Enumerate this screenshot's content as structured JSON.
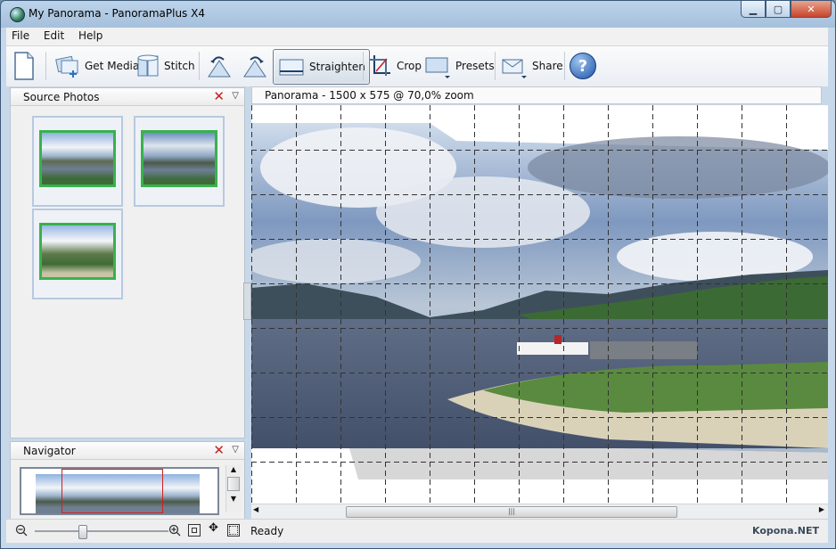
{
  "window": {
    "title": "My Panorama - PanoramaPlus X4",
    "controls": {
      "minimize": "▁",
      "maximize": "▢",
      "close": "✕"
    }
  },
  "menu": {
    "items": [
      {
        "label": "File"
      },
      {
        "label": "Edit"
      },
      {
        "label": "Help"
      }
    ]
  },
  "toolbar": {
    "new_icon": "document-icon",
    "get_media": "Get Media",
    "stitch": "Stitch",
    "rotate_left_icon": "rotate-left-icon",
    "rotate_right_icon": "rotate-right-icon",
    "straighten": "Straighten",
    "crop": "Crop",
    "presets": "Presets",
    "share": "Share",
    "help_icon": "help-icon",
    "help_glyph": "?"
  },
  "source_photos": {
    "title": "Source Photos",
    "close_glyph": "✕",
    "menu_glyph": "▽",
    "photos": [
      {
        "name": "photo-1"
      },
      {
        "name": "photo-2"
      },
      {
        "name": "photo-3"
      }
    ]
  },
  "navigator": {
    "title": "Navigator",
    "close_glyph": "✕",
    "menu_glyph": "▽"
  },
  "canvas": {
    "info": "Panorama - 1500 x 575 @ 70,0% zoom",
    "scroll_grip": "|||"
  },
  "status": {
    "text": "Ready",
    "zoom_level": 0.35
  },
  "watermark": "Kopona.NET",
  "colors": {
    "accent": "#2f6fc1",
    "photo_border": "#38b24b",
    "close_red": "#c62020"
  }
}
